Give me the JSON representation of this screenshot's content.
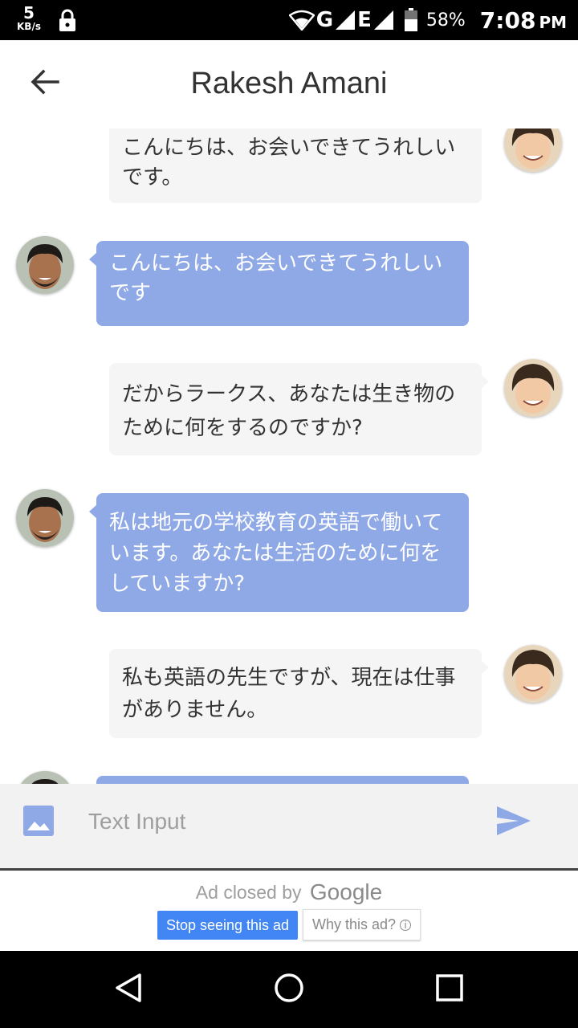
{
  "status_bar": {
    "speed_value": "5",
    "speed_unit": "KB/s",
    "network_1": "G",
    "network_2": "E",
    "battery": "58%",
    "time": "7:08",
    "ampm": "PM"
  },
  "header": {
    "title": "Rakesh Amani"
  },
  "messages": [
    {
      "side": "out",
      "text": "こんにちは、お会いできてうれしいです。"
    },
    {
      "side": "in",
      "text": "こんにちは、お会いできてうれしいです"
    },
    {
      "side": "out",
      "text": "だからラークス、あなたは生き物のために何をするのですか?"
    },
    {
      "side": "in",
      "text": "私は地元の学校教育の英語で働いています。あなたは生活のために何をしていますか?"
    },
    {
      "side": "out",
      "text": "私も英語の先生ですが、現在は仕事がありません。"
    }
  ],
  "composer": {
    "placeholder": "Text Input",
    "accent_color": "#8fa8e6"
  },
  "ad": {
    "closed_text": "Ad closed by",
    "brand": "Google",
    "stop_label": "Stop seeing this ad",
    "why_label": "Why this ad?"
  },
  "colors": {
    "incoming_bubble": "#8fa8e6",
    "outgoing_bubble": "#f5f5f5"
  }
}
